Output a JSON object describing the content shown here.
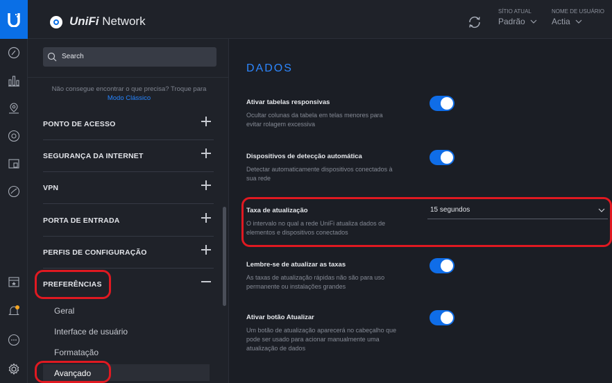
{
  "header": {
    "app_name_brand": "UniFi",
    "app_name_rest": " Network",
    "site_label": "SÍTIO ATUAL",
    "site_value": "Padrão",
    "user_label": "NOME DE USUÁRIO",
    "user_value": "Actia"
  },
  "sidebar": {
    "search_placeholder": "Search",
    "hint_text": "Não consegue encontrar o que precisa? Troque para",
    "hint_link": "Modo Clássico",
    "sections": [
      {
        "label": "PONTO DE ACESSO"
      },
      {
        "label": "SEGURANÇA DA INTERNET"
      },
      {
        "label": "VPN"
      },
      {
        "label": "PORTA DE ENTRADA"
      },
      {
        "label": "PERFIS DE CONFIGURAÇÃO"
      },
      {
        "label": "PREFERÊNCIAS"
      }
    ],
    "sub_items": [
      {
        "label": "Geral"
      },
      {
        "label": "Interface de usuário"
      },
      {
        "label": "Formatação"
      },
      {
        "label": "Avançado"
      }
    ]
  },
  "content": {
    "heading": "DADOS",
    "settings": [
      {
        "title": "Ativar tabelas responsivas",
        "desc": "Ocultar colunas da tabela em telas menores para evitar rolagem excessiva",
        "enabled": true
      },
      {
        "title": "Dispositivos de detecção automática",
        "desc": "Detectar automaticamente dispositivos conectados à sua rede",
        "enabled": true
      },
      {
        "title": "Taxa de atualização",
        "desc": "O intervalo no qual a rede UniFi atualiza dados de elementos e dispositivos conectados",
        "value": "15 segundos"
      },
      {
        "title": "Lembre-se de atualizar as taxas",
        "desc": "As taxas de atualização rápidas não são para uso permanente ou instalações grandes",
        "enabled": true
      },
      {
        "title": "Ativar botão Atualizar",
        "desc": "Um botão de atualização aparecerá no cabeçalho que pode ser usado para acionar manualmente uma atualização de dados",
        "enabled": true
      }
    ]
  },
  "colors": {
    "accent": "#0f6de8",
    "annotation": "#e01921",
    "background": "#1b1e25"
  }
}
